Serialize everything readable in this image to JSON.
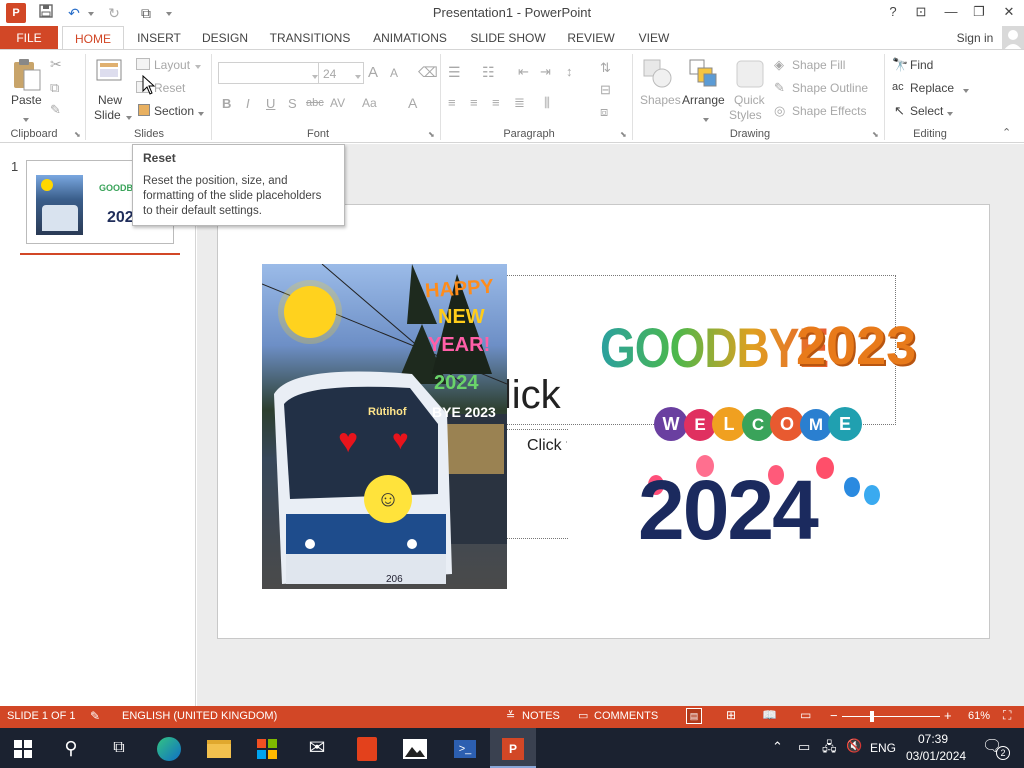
{
  "window": {
    "title": "Presentation1 - PowerPoint",
    "help": "?",
    "restore_ribbon": "⊡",
    "minimize": "—",
    "maximize": "❐",
    "close": "✕",
    "signin": "Sign in"
  },
  "tabs": [
    "FILE",
    "HOME",
    "INSERT",
    "DESIGN",
    "TRANSITIONS",
    "ANIMATIONS",
    "SLIDE SHOW",
    "REVIEW",
    "VIEW"
  ],
  "ribbon": {
    "clipboard": {
      "paste": "Paste",
      "group": "Clipboard"
    },
    "slides": {
      "new_slide_1": "New",
      "new_slide_2": "Slide",
      "layout": "Layout",
      "reset": "Reset",
      "section": "Section",
      "group": "Slides"
    },
    "font": {
      "size": "24",
      "group": "Font",
      "bold": "B",
      "italic": "I",
      "underline": "U",
      "shadow": "S",
      "strike": "abc",
      "spacing": "AV",
      "case": "Aa",
      "color": "A",
      "grow": "A",
      "shrink": "A"
    },
    "paragraph": {
      "group": "Paragraph"
    },
    "drawing": {
      "shapes": "Shapes",
      "arrange": "Arrange",
      "quick_styles_1": "Quick",
      "quick_styles_2": "Styles",
      "shape_fill": "Shape Fill",
      "shape_outline": "Shape Outline",
      "shape_effects": "Shape Effects",
      "group": "Drawing"
    },
    "editing": {
      "find": "Find",
      "replace": "Replace",
      "select": "Select",
      "group": "Editing"
    }
  },
  "tooltip": {
    "title": "Reset",
    "body": "Reset the position, size, and formatting of the slide placeholders to their default settings."
  },
  "thumbnails": {
    "number": "1"
  },
  "slide": {
    "title_placeholder": "Click to",
    "subtitle_placeholder": "Click t",
    "art": {
      "goodbye": "GOODBYE",
      "year_old": "2023",
      "welcome": [
        "W",
        "E",
        "L",
        "C",
        "O",
        "M",
        "E"
      ],
      "year_new": "2024",
      "bus_sign": "Rütihof",
      "bus_number": "206",
      "photo_text": [
        "HAPPY",
        "NEW",
        "YEAR!",
        "2024",
        "BYE 2023"
      ]
    }
  },
  "status": {
    "slide": "SLIDE 1 OF 1",
    "language": "ENGLISH (UNITED KINGDOM)",
    "notes": "NOTES",
    "comments": "COMMENTS",
    "zoom_minus": "−",
    "zoom_plus": "+",
    "zoom": "61%"
  },
  "taskbar": {
    "language": "ENG",
    "time": "07:39",
    "date": "03/01/2024",
    "notifications": "2"
  },
  "colors": {
    "accent": "#d24726",
    "taskbar": "#1b2230"
  }
}
